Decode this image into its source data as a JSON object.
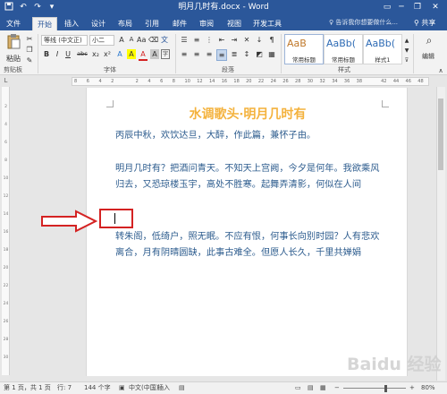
{
  "titlebar": {
    "title": "明月几时有.docx - Word",
    "save_icon": "save-icon",
    "undo_icon": "undo-icon",
    "redo_icon": "redo-icon",
    "customize_icon": "customize-icon",
    "minimize": "─",
    "restore": "❐",
    "close": "✕",
    "ribbon_display": "▭",
    "user": "?"
  },
  "tabs": {
    "file": "文件",
    "home": "开始",
    "insert": "插入",
    "design": "设计",
    "layout": "布局",
    "references": "引用",
    "mailings": "邮件",
    "review": "审阅",
    "view": "视图",
    "developer": "开发工具",
    "tell_me": "告诉我你想要做什么...",
    "share": "共享"
  },
  "ribbon": {
    "paste": "粘贴",
    "clipboard_label": "剪贴板",
    "font_name": "等线 (中文正)",
    "font_size": "小二",
    "font_label": "字体",
    "paragraph_label": "段落",
    "styles_label": "样式",
    "bold": "B",
    "italic": "I",
    "underline": "U",
    "strike": "abc",
    "subscript": "x₂",
    "superscript": "x²",
    "font_color": "A",
    "highlight": "A",
    "char_shading": "A",
    "styles": [
      {
        "sample": "AaB",
        "name": "常用标题",
        "color": "#c0782a"
      },
      {
        "sample": "AaBb(",
        "name": "常用标题",
        "color": "#2e6bb5"
      },
      {
        "sample": "AaBb(",
        "name": "样式1",
        "color": "#2e6bb5"
      }
    ],
    "editing": "编辑"
  },
  "ruler": {
    "corner": "L",
    "numbers": [
      "8",
      "6",
      "4",
      "2",
      "",
      "2",
      "4",
      "6",
      "8",
      "10",
      "12",
      "14",
      "16",
      "18",
      "20",
      "22",
      "24",
      "26",
      "28",
      "30",
      "32",
      "34",
      "36",
      "38",
      "",
      "42",
      "44",
      "46",
      "48"
    ]
  },
  "vruler": {
    "numbers": [
      "2",
      "4",
      "6",
      "8",
      "10",
      "12",
      "14",
      "16",
      "18",
      "20",
      "22",
      "24",
      "26",
      "28",
      "30"
    ]
  },
  "document": {
    "title": "水调歌头·明月几时有",
    "para1": "丙辰中秋，欢饮达旦，大醉，作此篇，兼怀子由。",
    "para2": "明月几时有？把酒问青天。不知天上宫阙，今夕是何年。我欲乘风归去，又恐琼楼玉宇，高处不胜寒。起舞弄清影，何似在人间",
    "para3": "转朱阁，低绮户，照无眠。不应有恨，何事长向别时园？人有悲欢离合，月有阴晴圆缺，此事古难全。但愿人长久，千里共婵娟"
  },
  "statusbar": {
    "page": "第 1 页，共 1 页",
    "row": "行: 7",
    "words": "144 个字",
    "language": "中文(中国)",
    "insert_mode": "插入",
    "zoom": "80%",
    "minus": "−",
    "plus": "+"
  },
  "watermark": "Baidu 经验",
  "colors": {
    "accent": "#2b579a",
    "title_gold": "#f4b23d",
    "body_blue": "#2d5c8e",
    "annotation_red": "#d42222"
  }
}
